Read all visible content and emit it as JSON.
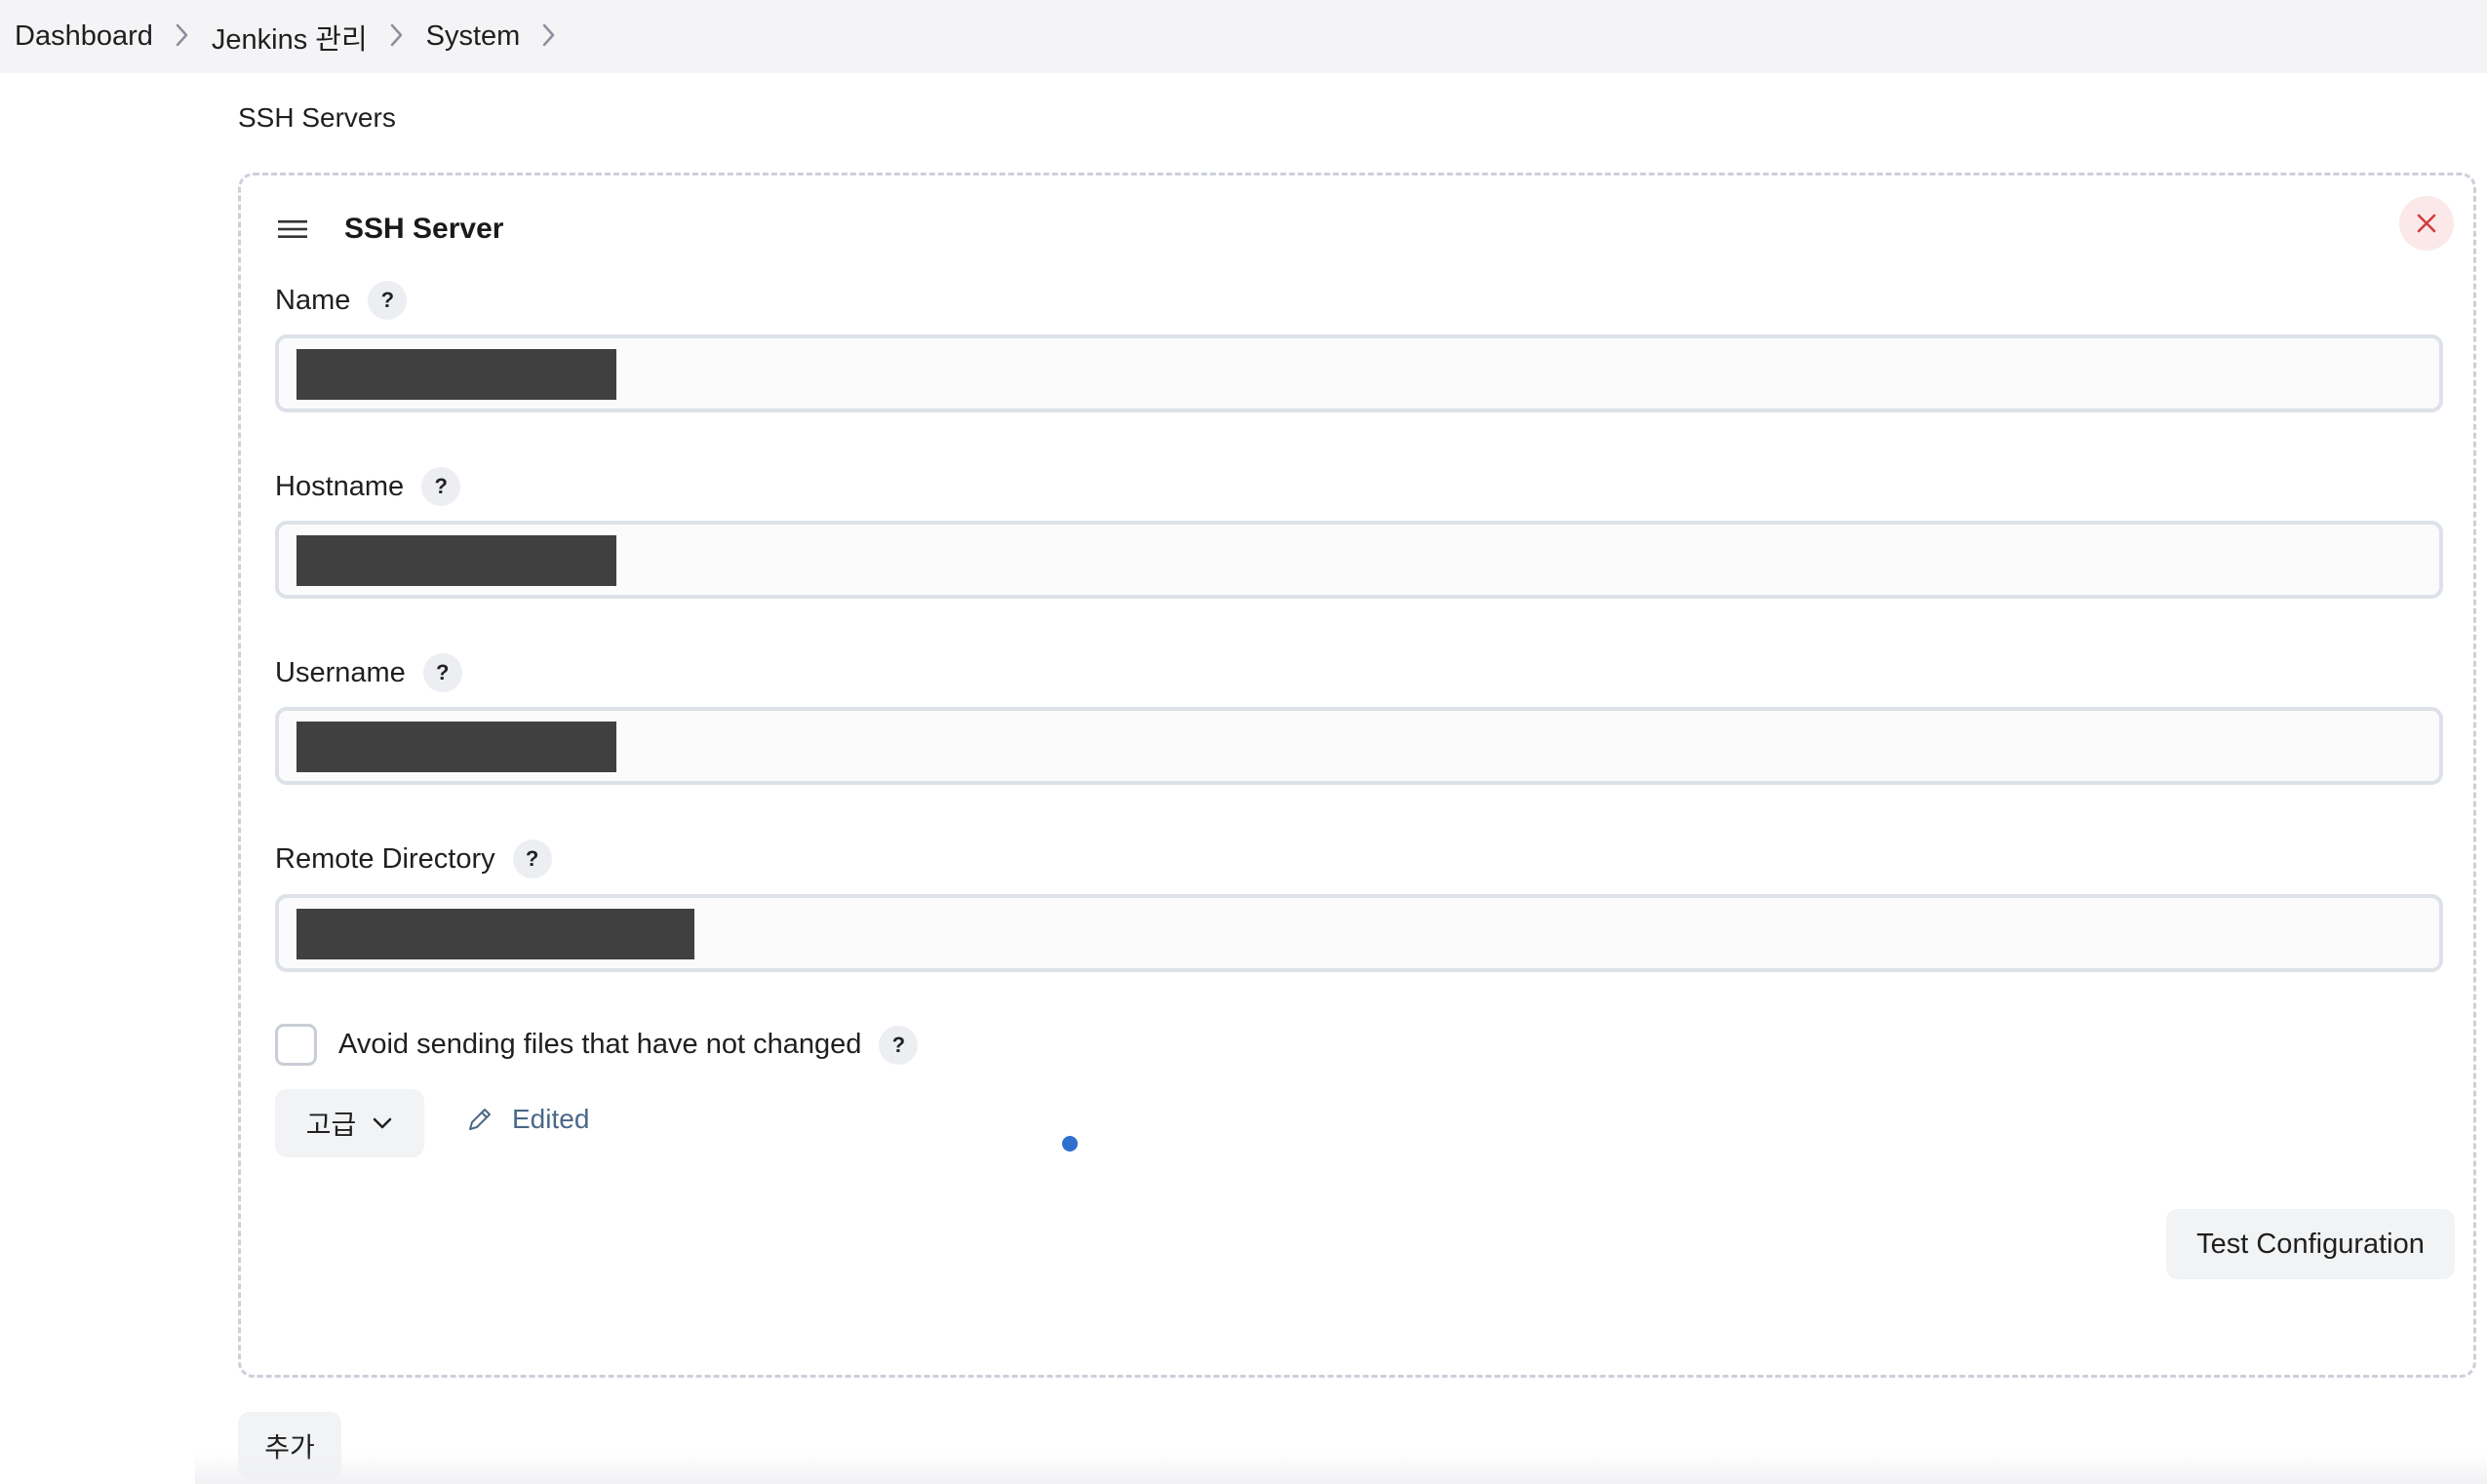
{
  "breadcrumb": {
    "items": [
      "Dashboard",
      "Jenkins 관리",
      "System"
    ]
  },
  "section": {
    "title": "SSH Servers"
  },
  "server": {
    "title": "SSH Server",
    "fields": {
      "name": {
        "label": "Name",
        "help": "?",
        "value_redacted": true
      },
      "hostname": {
        "label": "Hostname",
        "help": "?",
        "value_redacted": true
      },
      "username": {
        "label": "Username",
        "help": "?",
        "value_redacted": true
      },
      "remote_directory": {
        "label": "Remote Directory",
        "help": "?",
        "value_redacted": true
      }
    },
    "avoid_sending": {
      "label": "Avoid sending files that have not changed",
      "checked": false,
      "help": "?"
    },
    "advanced_button": "고급",
    "edited_label": "Edited",
    "test_button": "Test Configuration"
  },
  "add_button": "추가",
  "colors": {
    "breadcrumb_bg": "#f4f4f6",
    "delete_bg": "#fbe9ea",
    "delete_icon": "#d23c3c",
    "edited_text": "#4b6888",
    "status_dot": "#2f6fd0",
    "redaction": "#404040"
  },
  "icons": {
    "breadcrumb_separator": "chevron-right-icon",
    "drag_handle": "hamburger-icon",
    "delete": "close-icon",
    "advanced": "chevron-down-icon",
    "edited": "pencil-icon"
  }
}
